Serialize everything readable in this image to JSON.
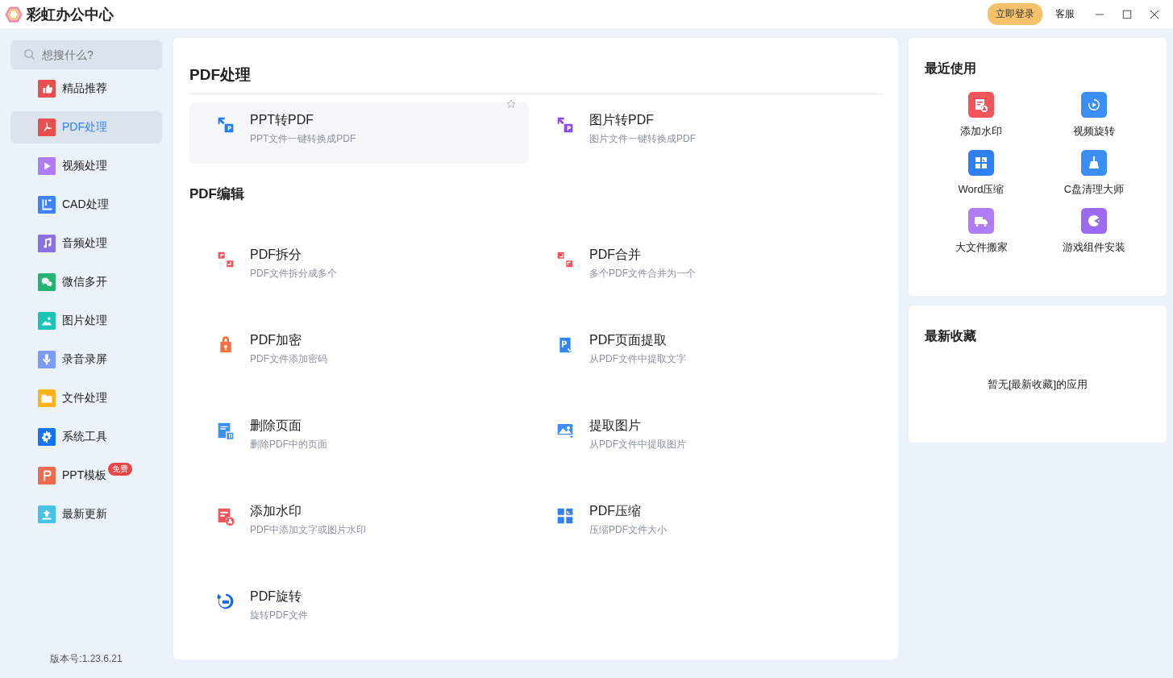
{
  "app": {
    "title": "彩虹办公中心",
    "login_button": "立即登录",
    "service_link": "客服"
  },
  "sidebar": {
    "search": {
      "placeholder": "想搜什么?"
    },
    "items": [
      {
        "label": "精品推荐",
        "kind": "thumb",
        "color": "#e8504f",
        "selected": false
      },
      {
        "label": "PDF处理",
        "kind": "pdf",
        "color": "#e8504f",
        "selected": true
      },
      {
        "label": "视频处理",
        "kind": "play",
        "color": "#b07cf6",
        "selected": false
      },
      {
        "label": "CAD处理",
        "kind": "cad",
        "color": "#3d82f6",
        "selected": false
      },
      {
        "label": "音频处理",
        "kind": "music",
        "color": "#8a70e0",
        "selected": false
      },
      {
        "label": "微信多开",
        "kind": "chat",
        "color": "#22b573",
        "selected": false
      },
      {
        "label": "图片处理",
        "kind": "image",
        "color": "#1cc4b8",
        "selected": false
      },
      {
        "label": "录音录屏",
        "kind": "mic",
        "color": "#7b9cf5",
        "selected": false
      },
      {
        "label": "文件处理",
        "kind": "folder",
        "color": "#ffb31a",
        "selected": false
      },
      {
        "label": "系统工具",
        "kind": "gear",
        "color": "#1673f0",
        "selected": false
      },
      {
        "label": "PPT模板",
        "kind": "p",
        "color": "#ee6b4d",
        "selected": false,
        "badge": "免费"
      },
      {
        "label": "最新更新",
        "kind": "upload",
        "color": "#45c4e8",
        "selected": false
      }
    ],
    "version": "版本号:1.23.6.21"
  },
  "sections": [
    {
      "title": "PDF处理",
      "tools": [
        {
          "name": "PPT转PDF",
          "desc": "PPT文件一键转换成PDF",
          "kind": "convert",
          "color": "#1e7ff5",
          "highlighted": true
        },
        {
          "name": "图片转PDF",
          "desc": "图片文件一键转换成PDF",
          "kind": "convert",
          "color": "#8a4cf0",
          "highlighted": false
        }
      ]
    },
    {
      "title": "PDF编辑",
      "tools": [
        {
          "name": "PDF拆分",
          "desc": "PDF文件拆分成多个",
          "kind": "split",
          "color": "#f5555a",
          "highlighted": false
        },
        {
          "name": "PDF合并",
          "desc": "多个PDF文件合并为一个",
          "kind": "merge",
          "color": "#f5555a",
          "highlighted": false
        },
        {
          "name": "PDF加密",
          "desc": "PDF文件添加密码",
          "kind": "lock",
          "color": "#f5703f",
          "highlighted": false
        },
        {
          "name": "PDF页面提取",
          "desc": "从PDF文件中提取文字",
          "kind": "page",
          "color": "#2f86f6",
          "highlighted": false
        },
        {
          "name": "删除页面",
          "desc": "删除PDF中的页面",
          "kind": "delete",
          "color": "#3a8ef6",
          "highlighted": false
        },
        {
          "name": "提取图片",
          "desc": "从PDF文件中提取图片",
          "kind": "picture",
          "color": "#3a8ef6",
          "highlighted": false
        },
        {
          "name": "添加水印",
          "desc": "PDF中添加文字或图片水印",
          "kind": "stamp",
          "color": "#f5555a",
          "highlighted": false
        },
        {
          "name": "PDF压缩",
          "desc": "压缩PDF文件大小",
          "kind": "compress",
          "color": "#2f7ff5",
          "highlighted": false
        },
        {
          "name": "PDF旋转",
          "desc": "旋转PDF文件",
          "kind": "rotate",
          "color": "#1167e8",
          "highlighted": false
        }
      ]
    }
  ],
  "recent": {
    "title": "最近使用",
    "items": [
      {
        "label": "添加水印",
        "kind": "stamp",
        "color": "#f5555a"
      },
      {
        "label": "视频旋转",
        "kind": "replay",
        "color": "#3a8ef6"
      },
      {
        "label": "Word压缩",
        "kind": "compress",
        "color": "#2f7ff5"
      },
      {
        "label": "C盘清理大师",
        "kind": "broom",
        "color": "#3a8ef6"
      },
      {
        "label": "大文件搬家",
        "kind": "truck",
        "color": "#b07cf6"
      },
      {
        "label": "游戏组件安装",
        "kind": "game",
        "color": "#9c6af0"
      }
    ]
  },
  "favorites": {
    "title": "最新收藏",
    "empty_text": "暂无[最新收藏]的应用"
  }
}
